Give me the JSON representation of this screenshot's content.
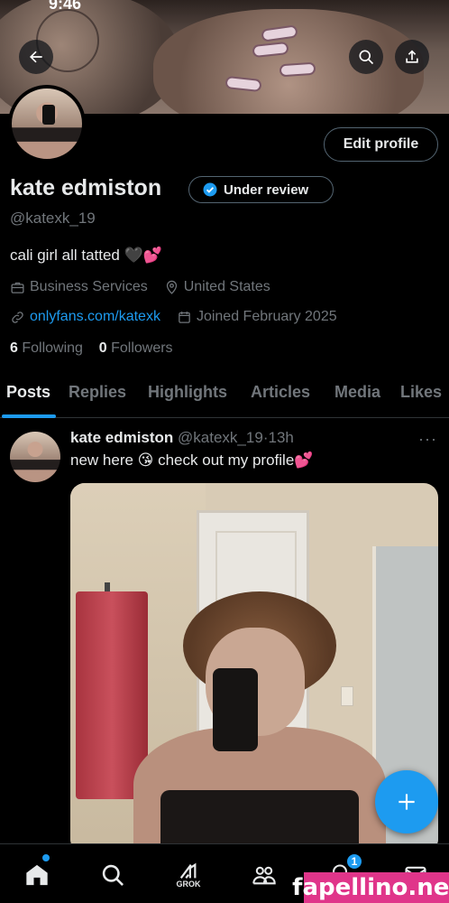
{
  "status_bar": {
    "time": "9:46"
  },
  "profile": {
    "name": "kate edmiston",
    "review_badge": "Under review",
    "handle": "@katexk_19",
    "bio": "cali girl all tatted 🖤💕",
    "category": "Business Services",
    "location": "United States",
    "website": "onlyfans.com/katexk",
    "joined": "Joined February 2025",
    "following_count": "6",
    "following_label": "Following",
    "followers_count": "0",
    "followers_label": "Followers",
    "edit_button": "Edit profile"
  },
  "tabs": [
    "Posts",
    "Replies",
    "Highlights",
    "Articles",
    "Media",
    "Likes"
  ],
  "post": {
    "author": "kate edmiston",
    "handle": "@katexk_19",
    "separator": "·",
    "time": "13h",
    "text": "new here 😘 check out my profile💕",
    "more": "···"
  },
  "bottom_nav": {
    "grok_label": "GROK",
    "notification_count": "1"
  },
  "watermark": "fapellino.net",
  "colors": {
    "accent": "#1d9bf0",
    "background": "#000000",
    "muted": "#71767b",
    "watermark": "#e0358a"
  }
}
